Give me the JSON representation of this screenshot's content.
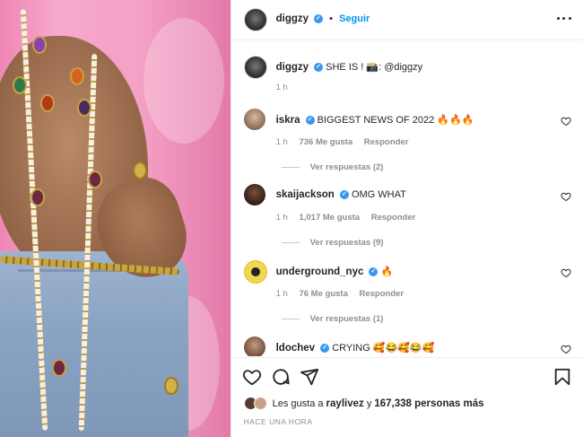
{
  "header": {
    "username": "diggzy",
    "separator": "•",
    "follow_label": "Seguir"
  },
  "caption": {
    "username": "diggzy",
    "text": "SHE IS ! 📸: @diggzy",
    "time": "1 h"
  },
  "comments": [
    {
      "username": "iskra",
      "text": "BIGGEST NEWS OF 2022 🔥🔥🔥",
      "time": "1 h",
      "likes": "736 Me gusta",
      "reply_label": "Responder",
      "view_replies": "Ver respuestas (2)"
    },
    {
      "username": "skaijackson",
      "text": "OMG WHAT",
      "time": "1 h",
      "likes": "1,017 Me gusta",
      "reply_label": "Responder",
      "view_replies": "Ver respuestas (9)"
    },
    {
      "username": "underground_nyc",
      "text": "🔥",
      "time": "1 h",
      "likes": "76 Me gusta",
      "reply_label": "Responder",
      "view_replies": "Ver respuestas (1)"
    },
    {
      "username": "ldochev",
      "text": "CRYING 🥰😂🥰😂🥰"
    }
  ],
  "likes": {
    "prefix": "Les gusta a",
    "user": "raylivez",
    "middle": "y",
    "count": "167,338 personas más"
  },
  "posted": "HACE UNA HORA",
  "colors": {
    "accent": "#0095f6",
    "verified": "#3897f0",
    "muted": "#8e8e8e",
    "text": "#262626"
  },
  "icons": [
    "more-icon",
    "heart-icon",
    "comment-icon",
    "share-icon",
    "bookmark-icon",
    "verified-icon"
  ]
}
